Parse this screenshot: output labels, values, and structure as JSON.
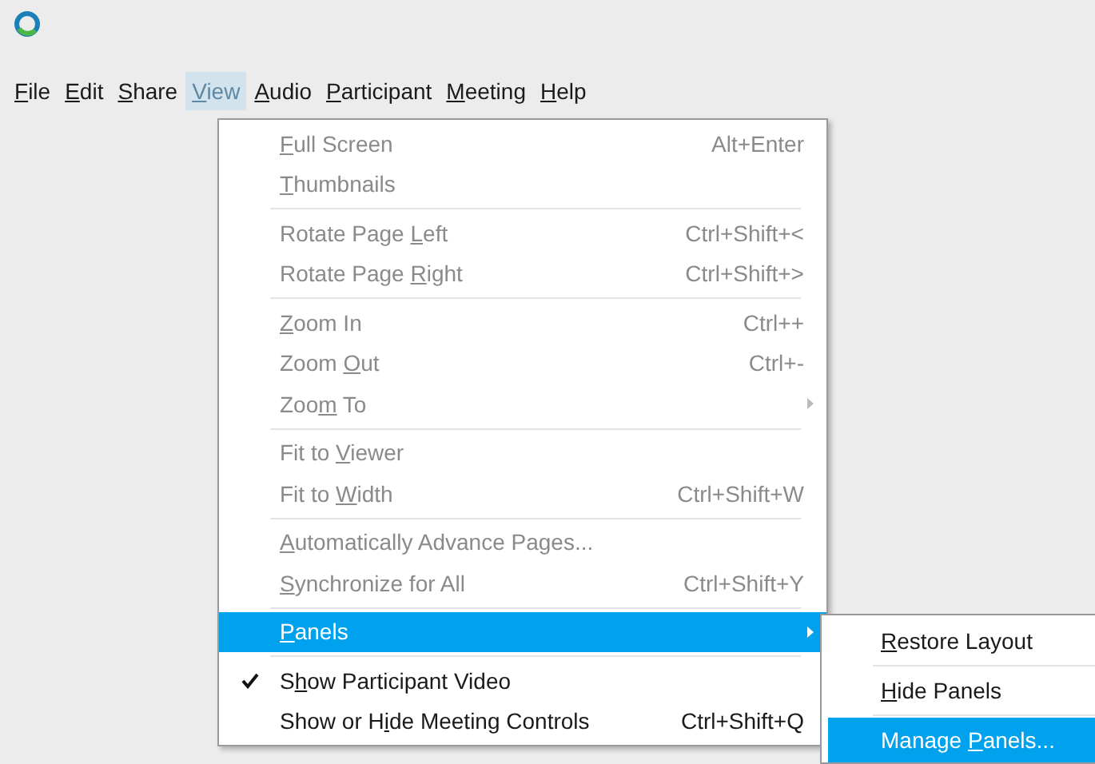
{
  "menu_bar": [
    {
      "underlined": "F",
      "after": "ile",
      "selected": false
    },
    {
      "underlined": "E",
      "after": "dit",
      "selected": false
    },
    {
      "underlined": "S",
      "after": "hare",
      "selected": false
    },
    {
      "underlined": "V",
      "after": "iew",
      "selected": true
    },
    {
      "underlined": "A",
      "after": "udio",
      "selected": false
    },
    {
      "underlined": "P",
      "after": "articipant",
      "selected": false
    },
    {
      "underlined": "M",
      "after": "eeting",
      "selected": false
    },
    {
      "underlined": "H",
      "after": "elp",
      "selected": false
    }
  ],
  "view_menu": [
    {
      "kind": "item",
      "underlined": "F",
      "after": "ull Screen",
      "shortcut": "Alt+Enter",
      "disabled": true,
      "selected": false,
      "checked": false,
      "submenu": false
    },
    {
      "kind": "item",
      "underlined": "T",
      "after": "humbnails",
      "disabled": true,
      "selected": false,
      "checked": false,
      "submenu": false
    },
    {
      "kind": "separator"
    },
    {
      "kind": "item",
      "before": "Rotate Page ",
      "underlined": "L",
      "after": "eft",
      "shortcut": "Ctrl+Shift+<",
      "disabled": true,
      "selected": false,
      "checked": false,
      "submenu": false
    },
    {
      "kind": "item",
      "before": "Rotate Page ",
      "underlined": "R",
      "after": "ight",
      "shortcut": "Ctrl+Shift+>",
      "disabled": true,
      "selected": false,
      "checked": false,
      "submenu": false
    },
    {
      "kind": "separator"
    },
    {
      "kind": "item",
      "underlined": "Z",
      "after": "oom In",
      "shortcut": "Ctrl++",
      "disabled": true,
      "selected": false,
      "checked": false,
      "submenu": false
    },
    {
      "kind": "item",
      "before": "Zoom ",
      "underlined": "O",
      "after": "ut",
      "shortcut": "Ctrl+-",
      "disabled": true,
      "selected": false,
      "checked": false,
      "submenu": false
    },
    {
      "kind": "item",
      "before": "Zoo",
      "underlined": "m",
      "after": " To",
      "disabled": true,
      "selected": false,
      "checked": false,
      "submenu": true
    },
    {
      "kind": "separator"
    },
    {
      "kind": "item",
      "before": "Fit to ",
      "underlined": "V",
      "after": "iewer",
      "disabled": true,
      "selected": false,
      "checked": false,
      "submenu": false
    },
    {
      "kind": "item",
      "before": "Fit to ",
      "underlined": "W",
      "after": "idth",
      "shortcut": "Ctrl+Shift+W",
      "disabled": true,
      "selected": false,
      "checked": false,
      "submenu": false
    },
    {
      "kind": "separator"
    },
    {
      "kind": "item",
      "underlined": "A",
      "after": "utomatically Advance Pages...",
      "disabled": true,
      "selected": false,
      "checked": false,
      "submenu": false
    },
    {
      "kind": "item",
      "underlined": "S",
      "after": "ynchronize for All",
      "shortcut": "Ctrl+Shift+Y",
      "disabled": true,
      "selected": false,
      "checked": false,
      "submenu": false
    },
    {
      "kind": "separator"
    },
    {
      "kind": "item",
      "underlined": "P",
      "after": "anels",
      "disabled": false,
      "selected": true,
      "checked": false,
      "submenu": true
    },
    {
      "kind": "separator"
    },
    {
      "kind": "item",
      "before": "S",
      "underlined": "h",
      "after": "ow Participant Video",
      "disabled": false,
      "selected": false,
      "checked": true,
      "submenu": false
    },
    {
      "kind": "item",
      "before": "Show or H",
      "underlined": "i",
      "after": "de Meeting Controls",
      "shortcut": "Ctrl+Shift+Q",
      "disabled": false,
      "selected": false,
      "checked": false,
      "submenu": false
    }
  ],
  "panels_submenu": [
    {
      "kind": "item",
      "underlined": "R",
      "after": "estore Layout",
      "selected": false
    },
    {
      "kind": "separator"
    },
    {
      "kind": "item",
      "underlined": "H",
      "after": "ide Panels",
      "selected": false
    },
    {
      "kind": "separator"
    },
    {
      "kind": "item",
      "before": "Manage ",
      "underlined": "P",
      "after": "anels...",
      "selected": true
    }
  ]
}
